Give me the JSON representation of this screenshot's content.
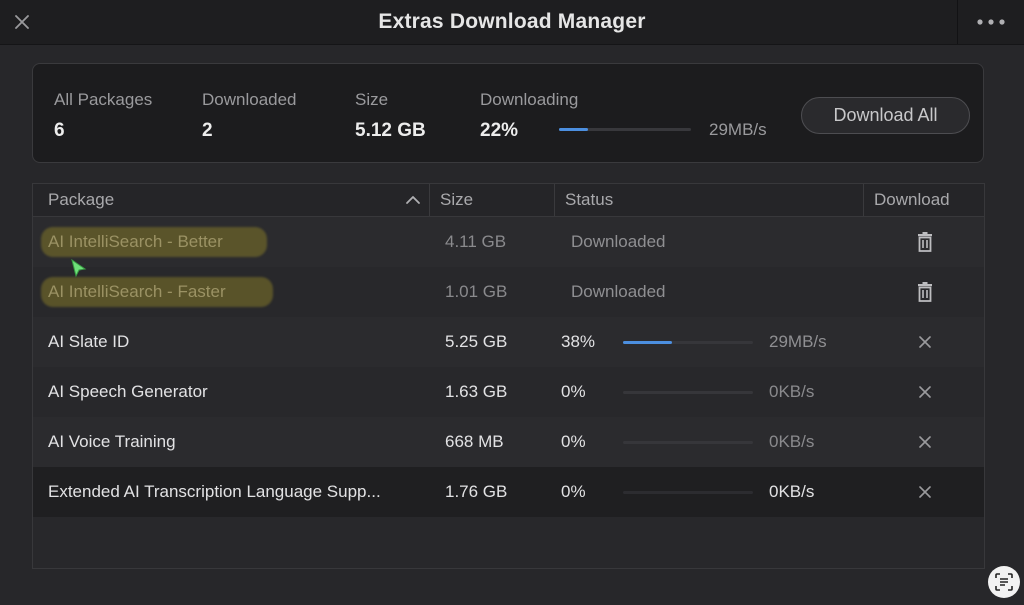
{
  "window": {
    "title": "Extras Download Manager",
    "close_icon": "close-icon",
    "more_icon": "more-horizontal-icon"
  },
  "summary": {
    "all_packages_label": "All Packages",
    "all_packages_value": "6",
    "downloaded_label": "Downloaded",
    "downloaded_value": "2",
    "size_label": "Size",
    "size_value": "5.12 GB",
    "downloading_label": "Downloading",
    "downloading_value": "22%",
    "progress_fraction": 0.22,
    "speed": "29MB/s",
    "download_all_label": "Download All"
  },
  "table": {
    "columns": {
      "package": "Package",
      "size": "Size",
      "status": "Status",
      "download": "Download"
    },
    "rows": [
      {
        "name": "AI IntelliSearch - Better",
        "size": "4.11 GB",
        "status": "Downloaded",
        "action_icon": "trash-icon"
      },
      {
        "name": "AI IntelliSearch - Faster",
        "size": "1.01 GB",
        "status": "Downloaded",
        "action_icon": "trash-icon"
      },
      {
        "name": "AI Slate ID",
        "size": "5.25 GB",
        "percent": "38%",
        "progress_fraction": 0.38,
        "speed": "29MB/s",
        "action_icon": "cancel-icon"
      },
      {
        "name": "AI Speech Generator",
        "size": "1.63 GB",
        "percent": "0%",
        "progress_fraction": 0,
        "speed": "0KB/s",
        "action_icon": "cancel-icon"
      },
      {
        "name": "AI Voice Training",
        "size": "668 MB",
        "percent": "0%",
        "progress_fraction": 0,
        "speed": "0KB/s",
        "action_icon": "cancel-icon"
      },
      {
        "name": "Extended AI Transcription Language Supp...",
        "size": "1.76 GB",
        "percent": "0%",
        "progress_fraction": 0,
        "speed": "0KB/s",
        "action_icon": "cancel-icon"
      }
    ]
  },
  "colors": {
    "accent": "#4c8fe0",
    "highlight": "#827628"
  }
}
